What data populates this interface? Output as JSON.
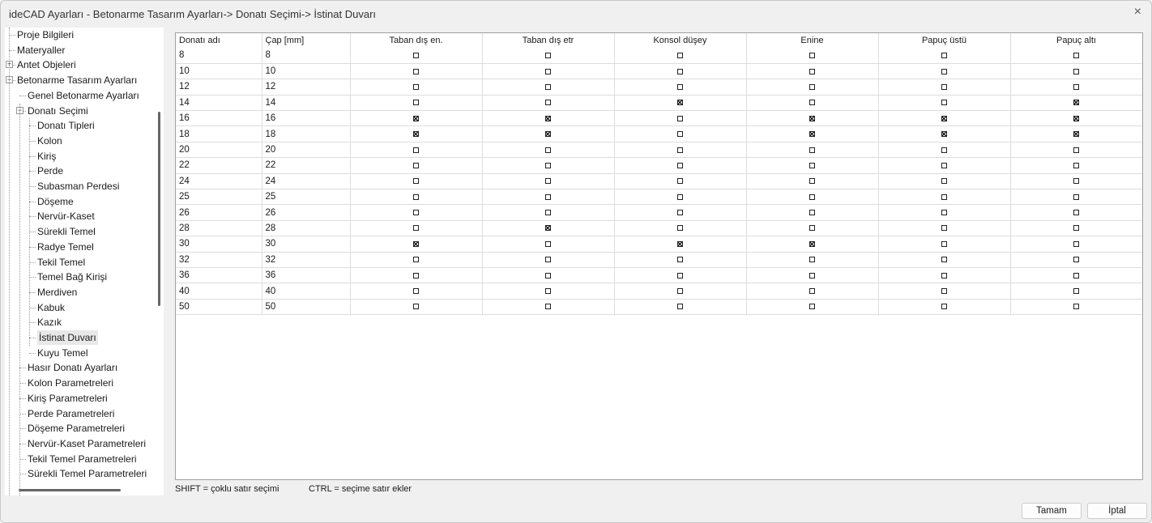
{
  "window": {
    "title": "ideCAD Ayarları - Betonarme Tasarım Ayarları-> Donatı Seçimi-> İstinat Duvarı",
    "close_icon": "×"
  },
  "tree": [
    {
      "label": "Proje Bilgileri",
      "level": 0
    },
    {
      "label": "Materyaller",
      "level": 0
    },
    {
      "label": "Antet Objeleri",
      "level": 0,
      "expander": "+"
    },
    {
      "label": "Betonarme Tasarım Ayarları",
      "level": 0,
      "expander": "-"
    },
    {
      "label": "Genel Betonarme Ayarları",
      "level": 1
    },
    {
      "label": "Donatı Seçimi",
      "level": 1,
      "expander": "-"
    },
    {
      "label": "Donatı Tipleri",
      "level": 2
    },
    {
      "label": "Kolon",
      "level": 2
    },
    {
      "label": "Kiriş",
      "level": 2
    },
    {
      "label": "Perde",
      "level": 2
    },
    {
      "label": "Subasman Perdesi",
      "level": 2
    },
    {
      "label": "Döşeme",
      "level": 2
    },
    {
      "label": "Nervür-Kaset",
      "level": 2
    },
    {
      "label": "Sürekli Temel",
      "level": 2
    },
    {
      "label": "Radye Temel",
      "level": 2
    },
    {
      "label": "Tekil Temel",
      "level": 2
    },
    {
      "label": "Temel Bağ Kirişi",
      "level": 2
    },
    {
      "label": "Merdiven",
      "level": 2
    },
    {
      "label": "Kabuk",
      "level": 2
    },
    {
      "label": "Kazık",
      "level": 2
    },
    {
      "label": "İstinat Duvarı",
      "level": 2,
      "selected": true
    },
    {
      "label": "Kuyu Temel",
      "level": 2
    },
    {
      "label": "Hasır Donatı Ayarları",
      "level": 1
    },
    {
      "label": "Kolon Parametreleri",
      "level": 1
    },
    {
      "label": "Kiriş Parametreleri",
      "level": 1
    },
    {
      "label": "Perde Parametreleri",
      "level": 1
    },
    {
      "label": "Döşeme Parametreleri",
      "level": 1
    },
    {
      "label": "Nervür-Kaset Parametreleri",
      "level": 1
    },
    {
      "label": "Tekil Temel Parametreleri",
      "level": 1
    },
    {
      "label": "Sürekli Temel Parametreleri",
      "level": 1
    }
  ],
  "table": {
    "columns": [
      "Donatı adı",
      "Çap [mm]",
      "Taban dış en.",
      "Taban dış etr",
      "Konsol düşey",
      "Enine",
      "Papuç üstü",
      "Papuç altı"
    ],
    "rows": [
      {
        "name": "8",
        "cap": "8",
        "checks": [
          0,
          0,
          0,
          0,
          0,
          0
        ]
      },
      {
        "name": "10",
        "cap": "10",
        "checks": [
          0,
          0,
          0,
          0,
          0,
          0
        ]
      },
      {
        "name": "12",
        "cap": "12",
        "checks": [
          0,
          0,
          0,
          0,
          0,
          0
        ]
      },
      {
        "name": "14",
        "cap": "14",
        "checks": [
          0,
          0,
          1,
          0,
          0,
          1
        ]
      },
      {
        "name": "16",
        "cap": "16",
        "checks": [
          1,
          1,
          0,
          1,
          1,
          1
        ]
      },
      {
        "name": "18",
        "cap": "18",
        "checks": [
          1,
          1,
          0,
          1,
          1,
          1
        ]
      },
      {
        "name": "20",
        "cap": "20",
        "checks": [
          0,
          0,
          0,
          0,
          0,
          0
        ]
      },
      {
        "name": "22",
        "cap": "22",
        "checks": [
          0,
          0,
          0,
          0,
          0,
          0
        ]
      },
      {
        "name": "24",
        "cap": "24",
        "checks": [
          0,
          0,
          0,
          0,
          0,
          0
        ]
      },
      {
        "name": "25",
        "cap": "25",
        "checks": [
          0,
          0,
          0,
          0,
          0,
          0
        ]
      },
      {
        "name": "26",
        "cap": "26",
        "checks": [
          0,
          0,
          0,
          0,
          0,
          0
        ]
      },
      {
        "name": "28",
        "cap": "28",
        "checks": [
          0,
          1,
          0,
          0,
          0,
          0
        ]
      },
      {
        "name": "30",
        "cap": "30",
        "checks": [
          1,
          0,
          1,
          1,
          0,
          0
        ]
      },
      {
        "name": "32",
        "cap": "32",
        "checks": [
          0,
          0,
          0,
          0,
          0,
          0
        ]
      },
      {
        "name": "36",
        "cap": "36",
        "checks": [
          0,
          0,
          0,
          0,
          0,
          0
        ]
      },
      {
        "name": "40",
        "cap": "40",
        "checks": [
          0,
          0,
          0,
          0,
          0,
          0
        ]
      },
      {
        "name": "50",
        "cap": "50",
        "checks": [
          0,
          0,
          0,
          0,
          0,
          0
        ]
      }
    ]
  },
  "hints": {
    "shift": "SHIFT = çoklu satır seçimi",
    "ctrl": "CTRL = seçime satır ekler"
  },
  "buttons": {
    "ok": "Tamam",
    "cancel": "İptal"
  }
}
